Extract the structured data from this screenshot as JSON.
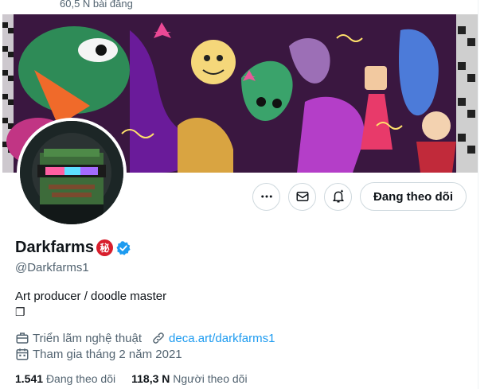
{
  "header": {
    "posts_count": "60,5 N bài đăng"
  },
  "profile": {
    "display_name": "Darkfarms",
    "name_emoji": "秘",
    "handle": "@Darkfarms1",
    "bio": "Art producer / doodle master",
    "bio_symbol": "❐",
    "category": "Triển lãm nghệ thuật",
    "website": "deca.art/darkfarms1",
    "joined": "Tham gia tháng 2 năm 2021"
  },
  "actions": {
    "follow_label": "Đang theo dõi"
  },
  "stats": {
    "following_count": "1.541",
    "following_label": "Đang theo dõi",
    "followers_count": "118,3 N",
    "followers_label": "Người theo dõi"
  },
  "colors": {
    "accent": "#1d9bf0",
    "verified": "#1d9bf0",
    "muted": "#536471"
  },
  "icons": [
    "more-icon",
    "message-icon",
    "notification-bell-icon",
    "briefcase-icon",
    "link-icon",
    "calendar-icon",
    "verified-badge-icon"
  ]
}
